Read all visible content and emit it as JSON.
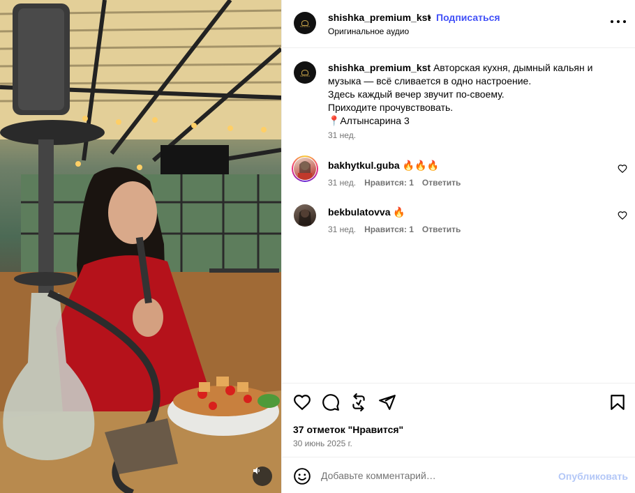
{
  "post": {
    "author": "shishka_premium_kst",
    "dot": "•",
    "follow_label": "Подписаться",
    "audio_label": "Оригинальное аудио",
    "more_icon": "more-horizontal-icon",
    "avatar_text": "SHISHKA"
  },
  "caption": {
    "user": "shishka_premium_kst",
    "lines": [
      "Авторская кухня, дымный кальян и",
      "музыка — всё сливается в одно настроение.",
      "Здесь каждый вечер звучит по-своему.",
      "Приходите прочувствовать.",
      "📍Алтынсарина 3"
    ],
    "time": "31 нед."
  },
  "comments": [
    {
      "user": "bakhytkul.guba",
      "text": "🔥🔥🔥",
      "time": "31 нед.",
      "likes": "Нравится: 1",
      "reply": "Ответить"
    },
    {
      "user": "bekbulatovva",
      "text": "🔥",
      "time": "31 нед.",
      "likes": "Нравится: 1",
      "reply": "Ответить"
    }
  ],
  "actions": {
    "likes_text": "37 отметок \"Нравится\"",
    "date": "30 июнь 2025 г.",
    "icons": [
      "heart-icon",
      "comment-icon",
      "repost-icon",
      "share-icon",
      "bookmark-icon"
    ]
  },
  "add_comment": {
    "placeholder": "Добавьте комментарий…",
    "publish_label": "Опубликовать"
  },
  "colors": {
    "link": "#4150f7",
    "muted": "#737373",
    "publish_disabled": "#b3c7f7"
  }
}
